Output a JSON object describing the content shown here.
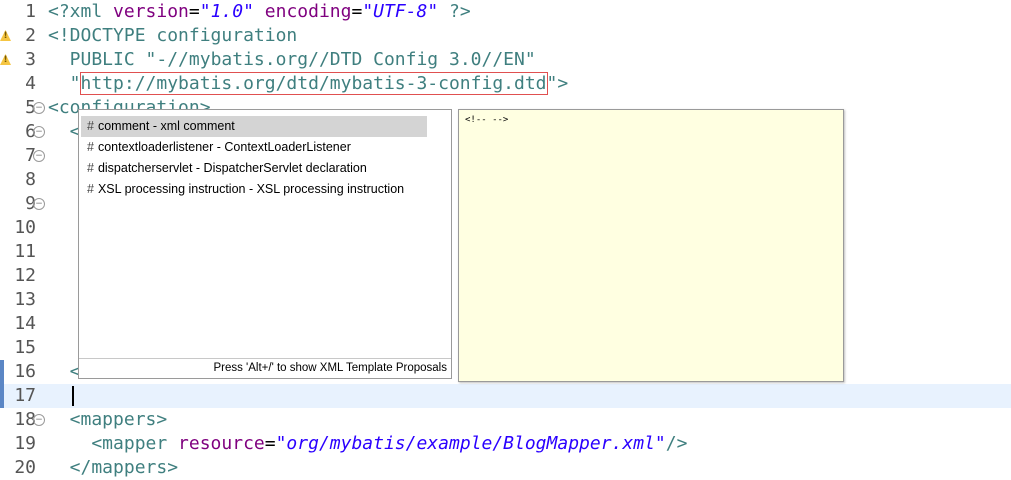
{
  "editor": {
    "lines": [
      {
        "n": "1",
        "parts": [
          [
            "tag",
            "<?xml "
          ],
          [
            "attr",
            "version"
          ],
          [
            "plain",
            "="
          ],
          [
            "str",
            "\"1.0\""
          ],
          [
            "plain",
            " "
          ],
          [
            "attr",
            "encoding"
          ],
          [
            "plain",
            "="
          ],
          [
            "str",
            "\"UTF-8\""
          ],
          [
            "tag",
            " ?>"
          ]
        ]
      },
      {
        "n": "2",
        "parts": [
          [
            "tag",
            "<!DOCTYPE configuration"
          ]
        ]
      },
      {
        "n": "3",
        "parts": [
          [
            "tag",
            "  PUBLIC "
          ],
          [
            "tag",
            "\"-//mybatis.org//DTD Config 3.0//EN\""
          ]
        ]
      },
      {
        "n": "4",
        "parts": [
          [
            "tag",
            "  \""
          ],
          [
            "tag",
            "http://mybatis.org/dtd/mybatis-3-config.dtd"
          ],
          [
            "tag",
            "\">"
          ]
        ]
      },
      {
        "n": "5",
        "parts": [
          [
            "tag",
            "<configuration>"
          ]
        ]
      },
      {
        "n": "6",
        "parts": [
          [
            "tag",
            "  <"
          ]
        ]
      },
      {
        "n": "7",
        "parts": []
      },
      {
        "n": "8",
        "parts": []
      },
      {
        "n": "9",
        "parts": []
      },
      {
        "n": "10",
        "parts": []
      },
      {
        "n": "11",
        "parts": []
      },
      {
        "n": "12",
        "parts": []
      },
      {
        "n": "13",
        "parts": []
      },
      {
        "n": "14",
        "parts": []
      },
      {
        "n": "15",
        "parts": []
      },
      {
        "n": "16",
        "parts": [
          [
            "tag",
            "  </environments>"
          ]
        ]
      },
      {
        "n": "17",
        "parts": []
      },
      {
        "n": "18",
        "parts": [
          [
            "tag",
            "  <mappers>"
          ]
        ]
      },
      {
        "n": "19",
        "parts": [
          [
            "tag",
            "    <mapper "
          ],
          [
            "attr",
            "resource"
          ],
          [
            "plain",
            "="
          ],
          [
            "str",
            "\"org/mybatis/example/BlogMapper.xml\""
          ],
          [
            "tag",
            "/>"
          ]
        ]
      },
      {
        "n": "20",
        "parts": [
          [
            "tag",
            "  </mappers>"
          ]
        ]
      }
    ]
  },
  "assist": {
    "items": [
      {
        "label": "comment - xml comment"
      },
      {
        "label": "contextloaderlistener - ContextLoaderListener"
      },
      {
        "label": "dispatcherservlet - DispatcherServlet declaration"
      },
      {
        "label": "XSL processing instruction - XSL processing instruction"
      }
    ],
    "footer": "Press 'Alt+/' to show XML Template Proposals",
    "doc_text": "<!--  -->"
  },
  "colors": {
    "tag": "#3f7f7f",
    "attribute": "#7f007f",
    "string": "#2a00ff",
    "current_line": "#e8f2fe",
    "doc_background": "#ffffe1",
    "warning": "#f5c542"
  },
  "icons": {
    "warning": "warning-icon",
    "fold": "fold-toggle-icon",
    "proposal": "template-proposal-icon"
  }
}
